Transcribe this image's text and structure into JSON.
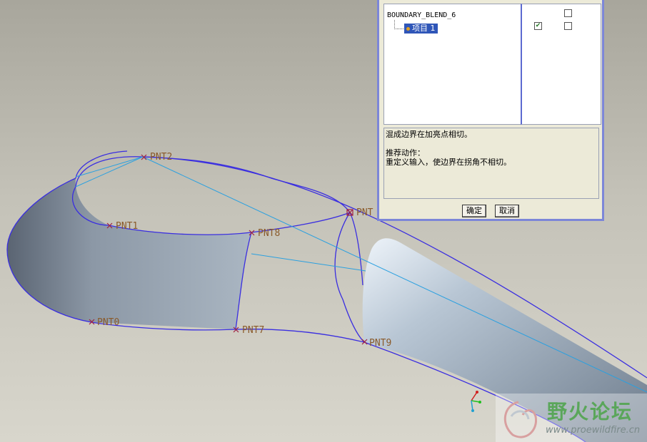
{
  "viewport": {
    "points": [
      "PNT2",
      "PNT1",
      "PNT8",
      "PNT",
      "PNT0",
      "PNT7",
      "PNT9"
    ]
  },
  "dialog": {
    "tree_root": "BOUNDARY_BLEND_6",
    "tree_item": "项目 1",
    "checkboxes": [
      {
        "row": 1,
        "col": 2,
        "checked": false
      },
      {
        "row": 2,
        "col": 1,
        "checked": true
      },
      {
        "row": 2,
        "col": 2,
        "checked": false
      }
    ],
    "message_line1": "混成边界在加亮点相切。",
    "message_line2": "推荐动作：",
    "message_line3": "重定义输入，使边界在拐角不相切。",
    "ok_label": "确定",
    "cancel_label": "取消"
  },
  "watermark": {
    "name": "野火论坛",
    "url": "www.proewildfire.cn"
  },
  "colors": {
    "curve": "#3a2ee0",
    "tangent_line": "#2aa0e0",
    "point_marker": "#a02040"
  }
}
